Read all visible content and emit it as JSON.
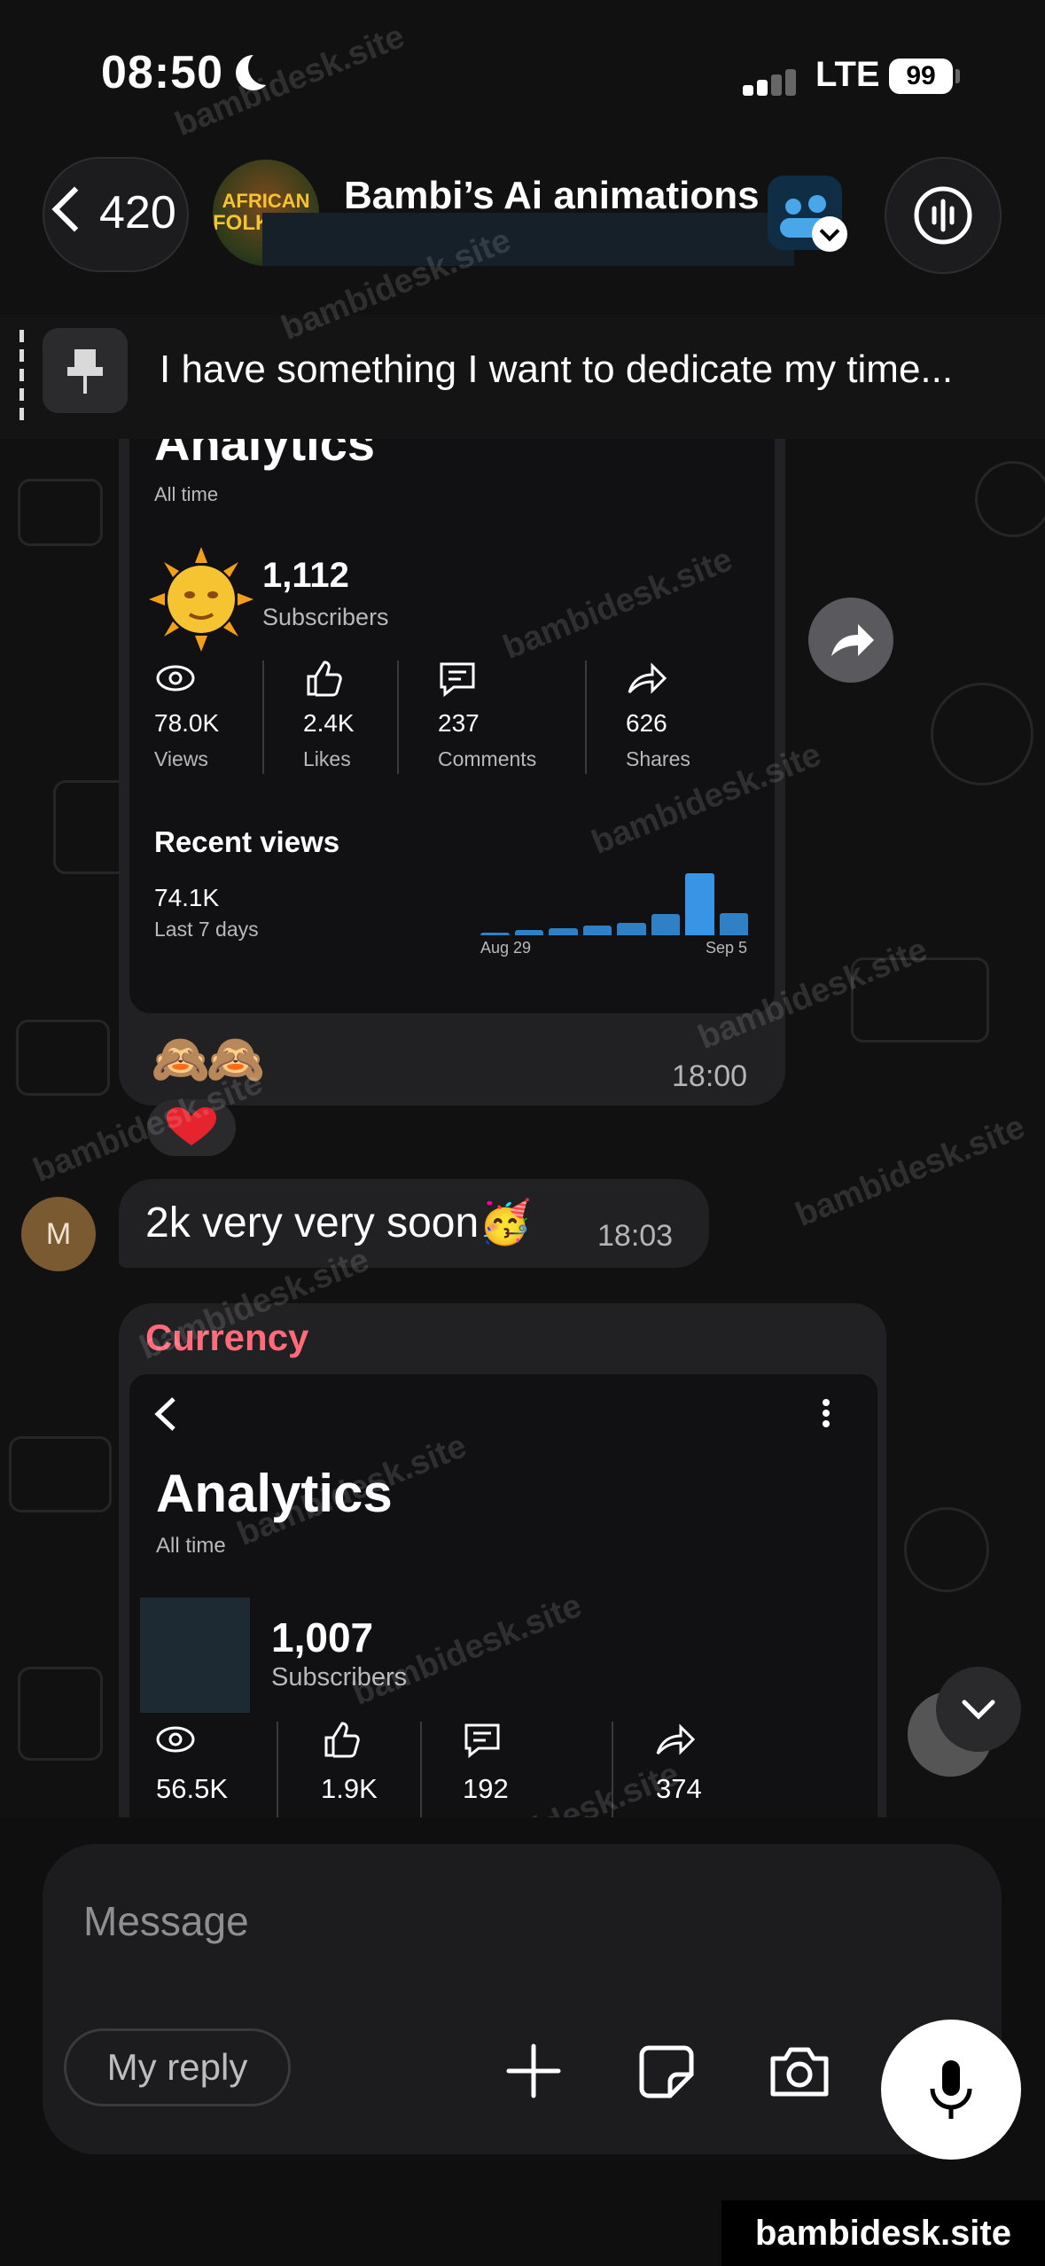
{
  "status_bar": {
    "time": "08:50",
    "network": "LTE",
    "battery": "99"
  },
  "header": {
    "back_count": "420",
    "channel_avatar_text_1": "AFRICAN",
    "channel_avatar_text_2": "FOLKLORE",
    "channel_title": "Bambi’s Ai animations"
  },
  "pinned": {
    "text": "I have something I want to dedicate my time..."
  },
  "message_1": {
    "analytics_title": "Analytics",
    "range": "All time",
    "subscribers_value": "1,112",
    "subscribers_label": "Subscribers",
    "stats": [
      {
        "value": "78.0K",
        "label": "Views"
      },
      {
        "value": "2.4K",
        "label": "Likes"
      },
      {
        "value": "237",
        "label": "Comments"
      },
      {
        "value": "626",
        "label": "Shares"
      }
    ],
    "recent_title": "Recent views",
    "recent_value": "74.1K",
    "recent_sub": "Last 7 days",
    "chart_start": "Aug 29",
    "chart_end": "Sep 5",
    "time": "18:00"
  },
  "message_2": {
    "author_initial": "M",
    "text": "2k very very soon🥳",
    "time": "18:03"
  },
  "message_3": {
    "sender": "Currency",
    "analytics_title": "Analytics",
    "range": "All time",
    "subscribers_value": "1,007",
    "subscribers_label": "Subscribers",
    "stats": [
      {
        "value": "56.5K"
      },
      {
        "value": "1.9K"
      },
      {
        "value": "192"
      },
      {
        "value": "374"
      }
    ]
  },
  "composer": {
    "placeholder": "Message",
    "reply_label": "My reply"
  },
  "watermark": {
    "text": "bambidesk.site"
  },
  "chart_data": {
    "type": "bar",
    "categories": [
      "",
      "",
      "",
      "",
      "",
      "",
      "",
      ""
    ],
    "values": [
      2,
      4,
      6,
      8,
      10,
      17,
      50,
      18
    ],
    "xlabel": "",
    "ylabel": ""
  },
  "colors": {
    "accent_blue": "#2f80c4",
    "sender_name": "#ff6b7a",
    "bubble": "#212123"
  }
}
